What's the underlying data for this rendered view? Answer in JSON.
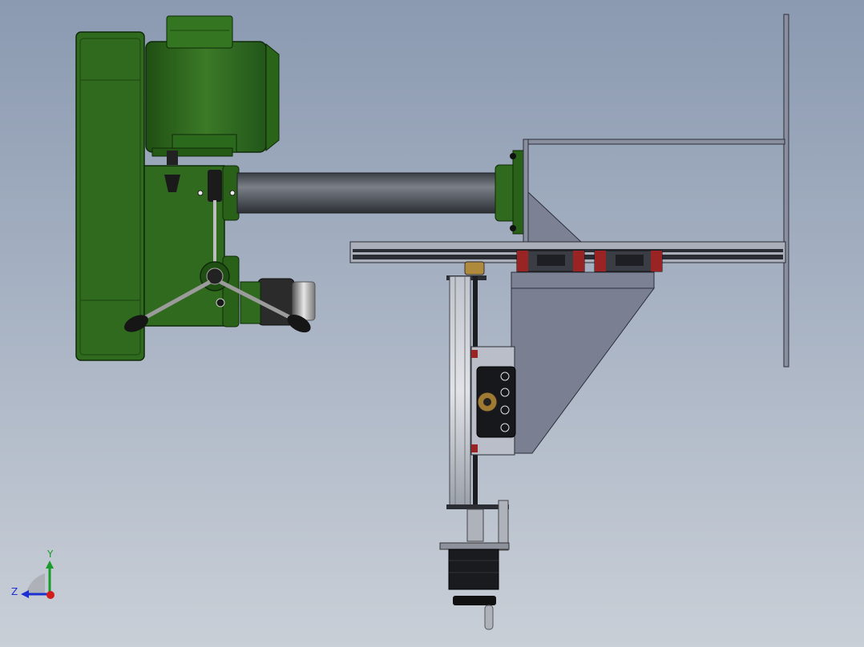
{
  "viewport": {
    "background_top": "#8b9ab1",
    "background_bottom": "#c9cfd7"
  },
  "colors": {
    "drill_green": "#2f6a1e",
    "drill_green_dark": "#1b4710",
    "steel_plate": "#7c8194",
    "steel_plate_light": "#9aa0b2",
    "rail_dark": "#2a2d33",
    "carriage_red": "#9a2323",
    "tube_grey": "#555a60",
    "axis_x": "#d21c1c",
    "axis_y": "#1a9a2a",
    "axis_z": "#1c2fd2"
  },
  "triad": {
    "y_label": "Y",
    "z_label": "Z",
    "x_icon": "x-axis-dot-icon"
  }
}
